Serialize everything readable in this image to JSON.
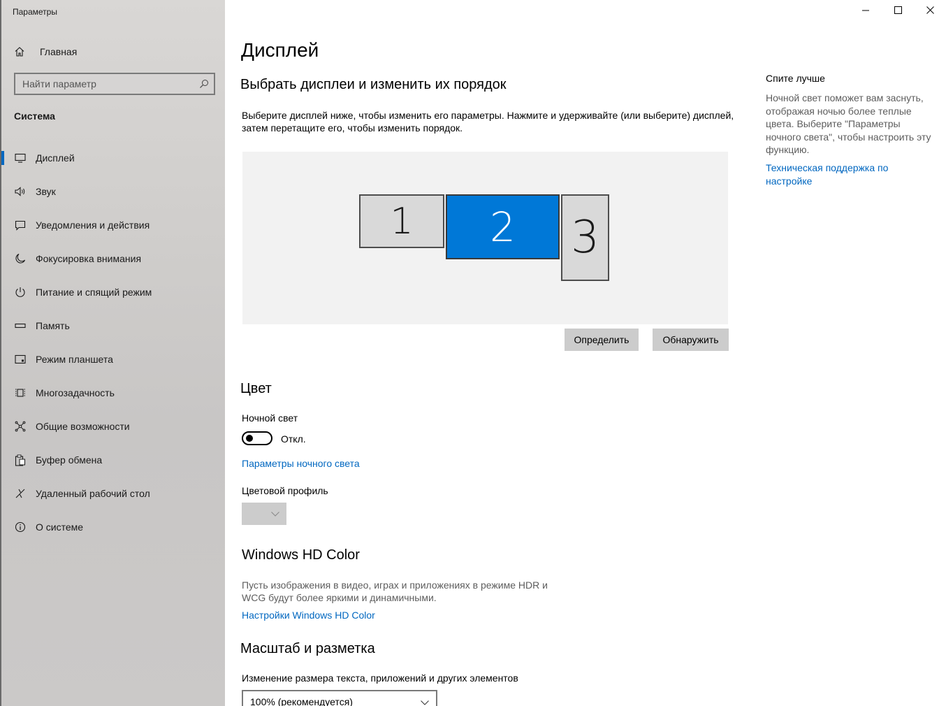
{
  "window": {
    "title": "Параметры"
  },
  "sidebar": {
    "home_label": "Главная",
    "search_placeholder": "Найти параметр",
    "section": "Система",
    "items": [
      {
        "label": "Дисплей",
        "icon": "monitor-icon",
        "active": true
      },
      {
        "label": "Звук",
        "icon": "speaker-icon"
      },
      {
        "label": "Уведомления и действия",
        "icon": "notification-icon"
      },
      {
        "label": "Фокусировка внимания",
        "icon": "moon-icon"
      },
      {
        "label": "Питание и спящий режим",
        "icon": "power-icon"
      },
      {
        "label": "Память",
        "icon": "storage-icon"
      },
      {
        "label": "Режим планшета",
        "icon": "tablet-icon"
      },
      {
        "label": "Многозадачность",
        "icon": "multitask-icon"
      },
      {
        "label": "Общие возможности",
        "icon": "share-icon"
      },
      {
        "label": "Буфер обмена",
        "icon": "clipboard-icon"
      },
      {
        "label": "Удаленный рабочий стол",
        "icon": "remote-desktop-icon"
      },
      {
        "label": "О системе",
        "icon": "info-icon"
      }
    ]
  },
  "main": {
    "title": "Дисплей",
    "arrange": {
      "heading": "Выбрать дисплеи и изменить их порядок",
      "description": "Выберите дисплей ниже, чтобы изменить его параметры. Нажмите и удерживайте (или выберите) дисплей, затем перетащите его, чтобы изменить порядок.",
      "monitors": [
        "1",
        "2",
        "3"
      ],
      "selected_monitor": "2",
      "identify_label": "Определить",
      "detect_label": "Обнаружить"
    },
    "color": {
      "heading": "Цвет",
      "night_light_label": "Ночной свет",
      "night_light_state": "Откл.",
      "night_light_settings_link": "Параметры ночного света",
      "color_profile_label": "Цветовой профиль"
    },
    "hdr": {
      "heading": "Windows HD Color",
      "description": "Пусть изображения в видео, играх и приложениях в режиме HDR и WCG будут более яркими и динамичными.",
      "settings_link": "Настройки Windows HD Color"
    },
    "scale": {
      "heading": "Масштаб и разметка",
      "size_label": "Изменение размера текста, приложений и других элементов",
      "size_value": "100% (рекомендуется)"
    }
  },
  "aside": {
    "title": "Спите лучше",
    "text": "Ночной свет поможет вам заснуть, отображая ночью более теплые цвета. Выберите \"Параметры ночного света\", чтобы настроить эту функцию.",
    "link": "Техническая поддержка по настройке"
  },
  "colors": {
    "accent": "#0078d7",
    "link": "#0067c0",
    "button": "#cccccc"
  }
}
